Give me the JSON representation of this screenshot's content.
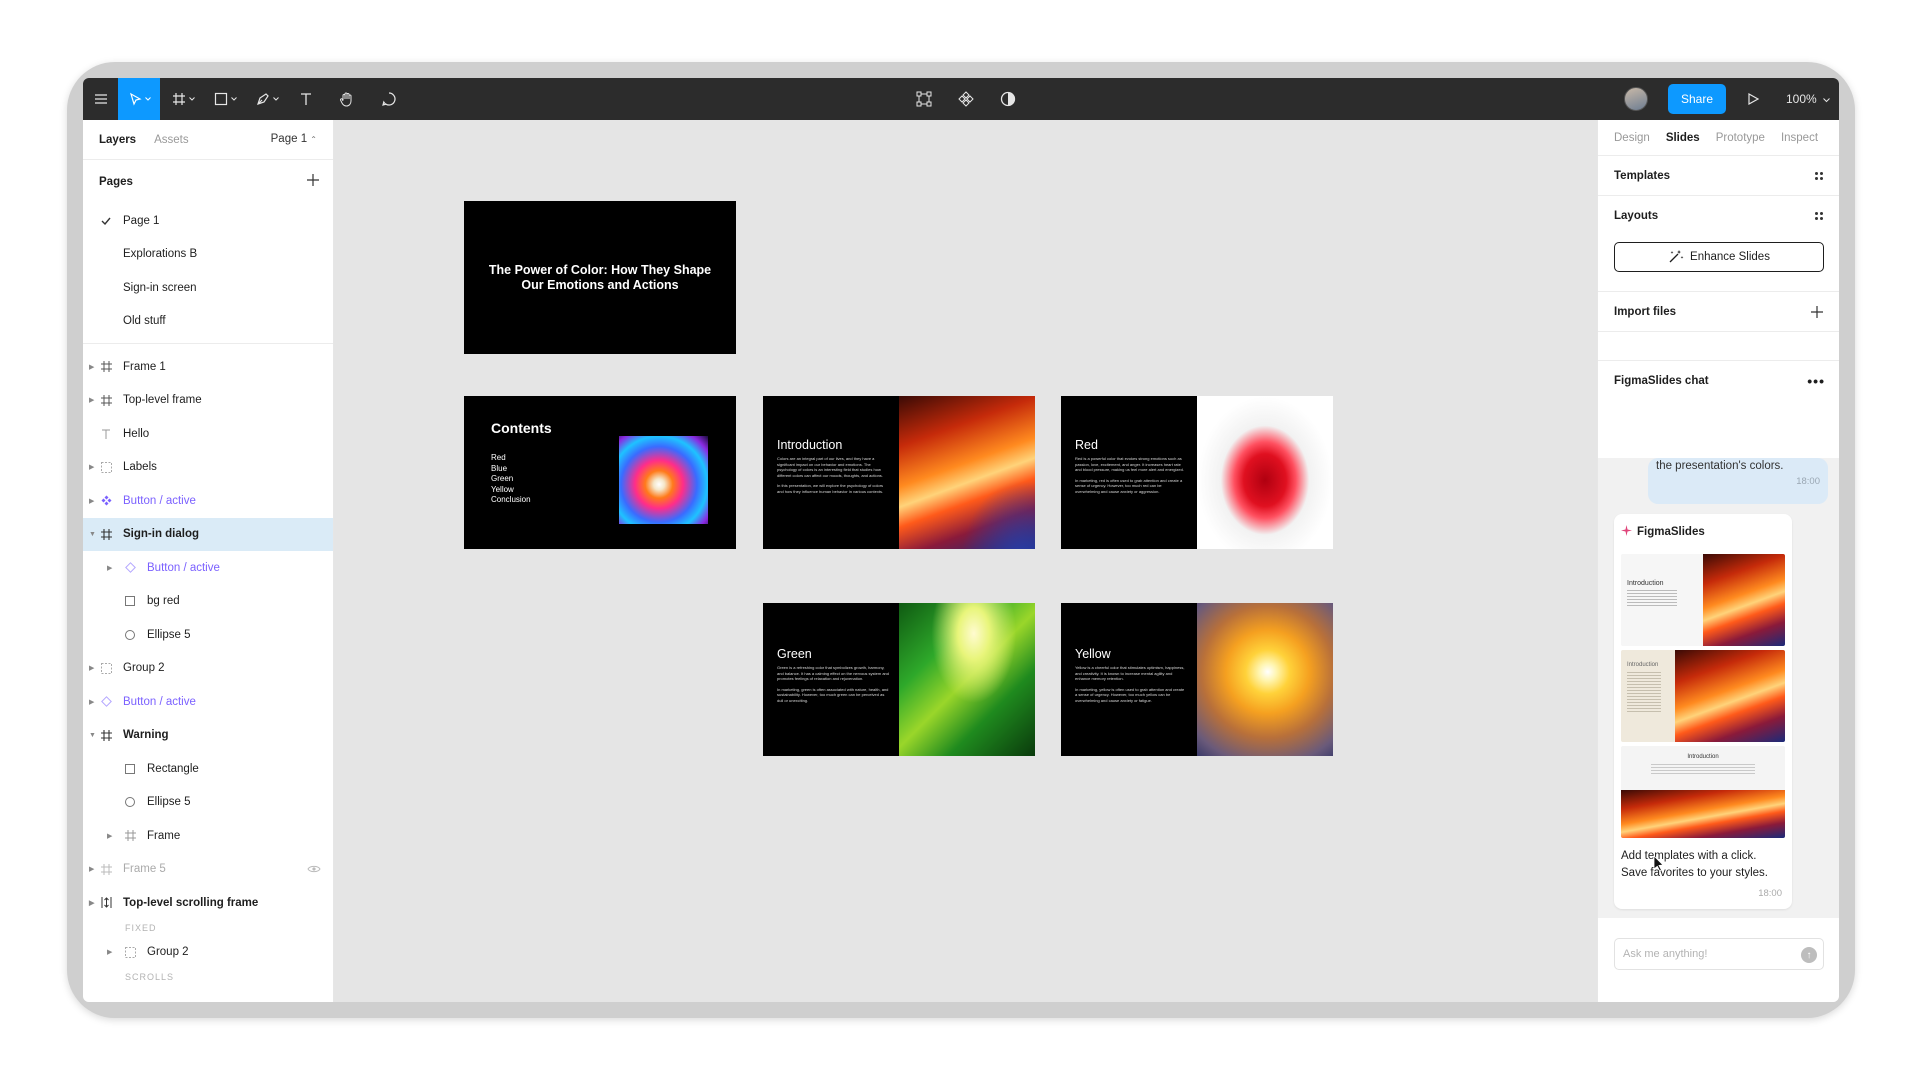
{
  "toolbar": {
    "share_label": "Share",
    "zoom_label": "100%"
  },
  "left_panel": {
    "tabs": [
      "Layers",
      "Assets"
    ],
    "current_page": "Page 1",
    "pages_header": "Pages",
    "pages": [
      "Page 1",
      "Explorations B",
      "Sign-in screen",
      "Old stuff"
    ],
    "layers": [
      "Frame 1",
      "Top-level frame",
      "Hello",
      "Labels",
      "Button / active",
      "Sign-in dialog",
      "Button / active",
      "bg red",
      "Ellipse 5",
      "Group 2",
      "Button / active",
      "Warning",
      "Rectangle",
      "Ellipse 5",
      "Frame",
      "Frame 5",
      "Top-level scrolling frame",
      "Group 2"
    ],
    "fixed_label": "FIXED",
    "scrolls_label": "SCROLLS"
  },
  "slides": {
    "title_slide": "The Power of Color: How They Shape Our Emotions and Actions",
    "contents": {
      "title": "Contents",
      "items": [
        "Red",
        "Blue",
        "Green",
        "Yellow",
        "Conclusion"
      ]
    },
    "introduction": {
      "title": "Introduction",
      "body1": "Colors are an integral part of our lives, and they have a significant impact on our behavior and emotions. The psychology of colors is an interesting field that studies how different colors can affect our moods, thoughts, and actions.",
      "body2": "In this presentation, we will explore the psychology of colors and how they influence human behavior in various contexts."
    },
    "red": {
      "title": "Red",
      "body1": "Red is a powerful color that evokes strong emotions such as passion, love, excitement, and anger. It increases heart rate and blood pressure, making us feel more alert and energized.",
      "body2": "In marketing, red is often used to grab attention and create a sense of urgency. However, too much red can be overwhelming and cause anxiety or aggression."
    },
    "green": {
      "title": "Green",
      "body1": "Green is a refreshing color that symbolizes growth, harmony, and balance. It has a calming effect on the nervous system and promotes feelings of relaxation and rejuvenation.",
      "body2": "In marketing, green is often associated with nature, health, and sustainability. However, too much green can be perceived as dull or unexciting."
    },
    "yellow": {
      "title": "Yellow",
      "body1": "Yellow is a cheerful color that stimulates optimism, happiness, and creativity. It is known to increase mental agility and enhance memory retention.",
      "body2": "In marketing, yellow is often used to grab attention and create a sense of urgency. However, too much yellow can be overwhelming and cause anxiety or fatigue."
    }
  },
  "right_panel": {
    "tabs": [
      "Design",
      "Slides",
      "Prototype",
      "Inspect"
    ],
    "templates_label": "Templates",
    "layouts_label": "Layouts",
    "enhance_label": "Enhance Slides",
    "import_label": "Import files",
    "chat_header": "FigmaSlides chat",
    "user_message": "the presentation's colors.",
    "user_time": "18:00",
    "bot_name": "FigmaSlides",
    "thumb_title": "Introduction",
    "bot_message_line1": "Add templates with a click.",
    "bot_message_line2": "Save favorites to your styles.",
    "bot_time": "18:00",
    "ask_placeholder": "Ask me anything!"
  },
  "colors": {
    "accent": "#0d99ff",
    "component_purple": "#7b61ff",
    "selection": "#daebf7",
    "toolbar_bg": "#2c2c2c"
  }
}
